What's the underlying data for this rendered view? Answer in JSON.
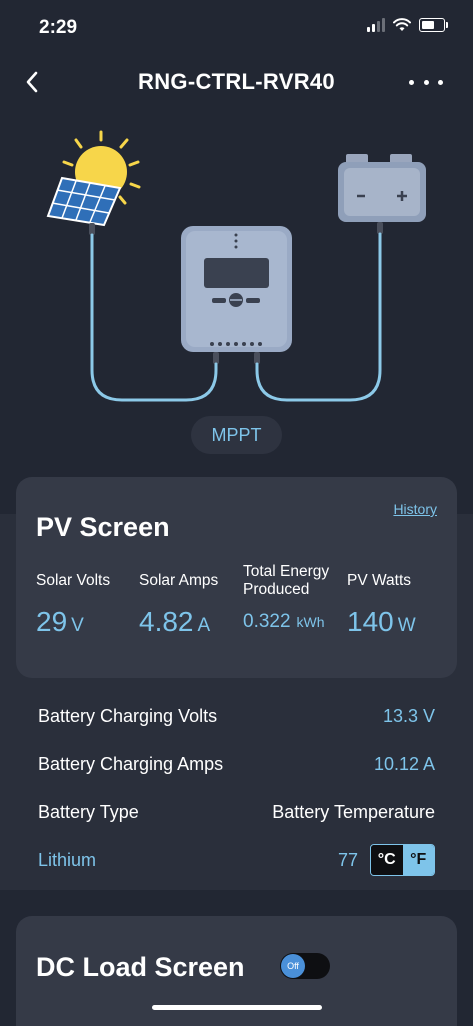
{
  "status": {
    "time": "2:29"
  },
  "nav": {
    "title": "RNG-CTRL-RVR40",
    "back_icon": "chevron-left-icon",
    "more_icon": "ellipsis-icon"
  },
  "diagram": {
    "mode_label": "MPPT"
  },
  "pv": {
    "title": "PV Screen",
    "history_label": "History",
    "metrics": [
      {
        "label": "Solar Volts",
        "value": "29",
        "unit": "V"
      },
      {
        "label": "Solar Amps",
        "value": "4.82",
        "unit": "A"
      },
      {
        "label": "Total Energy Produced",
        "value": "0.322",
        "unit": "kWh"
      },
      {
        "label": "PV Watts",
        "value": "140",
        "unit": "W"
      }
    ]
  },
  "battery": {
    "charging_volts_label": "Battery Charging Volts",
    "charging_volts_value": "13.3 V",
    "charging_amps_label": "Battery Charging Amps",
    "charging_amps_value": "10.12 A",
    "type_label": "Battery Type",
    "type_value": "Lithium",
    "temperature_label": "Battery Temperature",
    "temperature_value": "77",
    "unit_c": "°C",
    "unit_f": "°F",
    "unit_selected": "°F"
  },
  "dc_load": {
    "title": "DC Load Screen",
    "toggle_label": "Off",
    "toggle_on": false
  },
  "colors": {
    "accent": "#7ec4ea",
    "background": "#222733",
    "card": "#353a47",
    "sun": "#f7d64a"
  }
}
